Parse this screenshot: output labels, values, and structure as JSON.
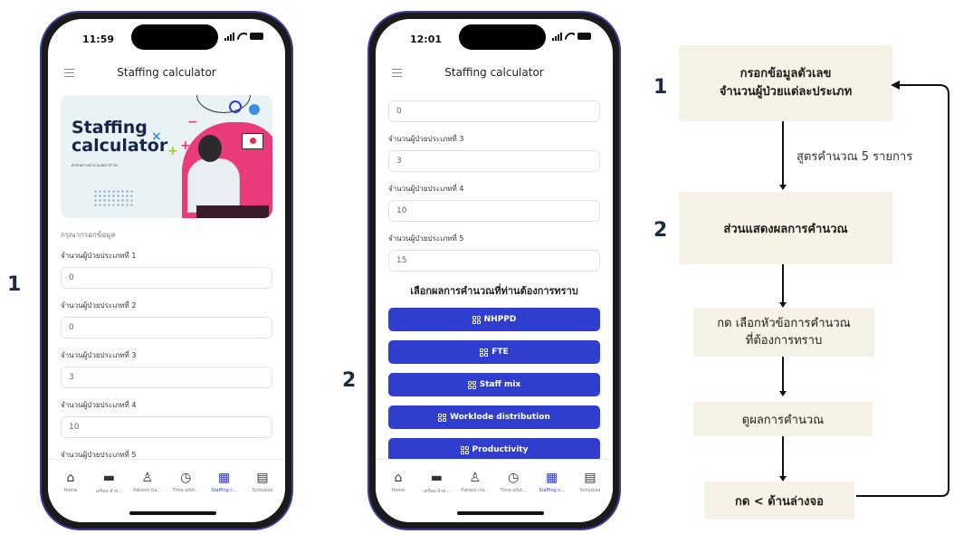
{
  "labels": {
    "step1": "1",
    "step2": "2"
  },
  "phone1": {
    "time": "11:59",
    "title": "Staffing calculator",
    "banner": {
      "title": "Staffing calculator",
      "subtitle": "ตัวช่วยการคำนวณอัตรากำลัง"
    },
    "hint": "กรุณากรอกข้อมูล",
    "fields": [
      {
        "label": "จำนวนผู้ป่วยประเภทที่ 1",
        "value": "0"
      },
      {
        "label": "จำนวนผู้ป่วยประเภทที่ 2",
        "value": "0"
      },
      {
        "label": "จำนวนผู้ป่วยประเภทที่ 3",
        "value": "3"
      },
      {
        "label": "จำนวนผู้ป่วยประเภทที่ 4",
        "value": "10"
      },
      {
        "label": "จำนวนผู้ป่วยประเภทที่ 5",
        "value": ""
      }
    ]
  },
  "phone2": {
    "time": "12:01",
    "title": "Staffing calculator",
    "fields": [
      {
        "label": "",
        "value": "0"
      },
      {
        "label": "จำนวนผู้ป่วยประเภทที่ 3",
        "value": "3"
      },
      {
        "label": "จำนวนผู้ป่วยประเภทที่ 4",
        "value": "10"
      },
      {
        "label": "จำนวนผู้ป่วยประเภทที่ 5",
        "value": "15"
      }
    ],
    "section_title": "เลือกผลการคำนวณที่ท่านต้องการทราบ",
    "buttons": [
      "NHPPD",
      "FTE",
      "Staff mix",
      "Worklode distribution",
      "Productivity"
    ]
  },
  "tabbar": {
    "items": [
      {
        "label": "Home",
        "icon": "home-icon"
      },
      {
        "label": "เตรียม-จำห...",
        "icon": "bed-icon"
      },
      {
        "label": "Patient cla...",
        "icon": "patient-icon"
      },
      {
        "label": "Time allot...",
        "icon": "clock-icon"
      },
      {
        "label": "Staffing c...",
        "icon": "calculator-icon"
      },
      {
        "label": "Schedule",
        "icon": "document-icon"
      }
    ],
    "active_color": "#2f3ecf"
  },
  "flow": {
    "num1": "1",
    "num2": "2",
    "box1": "กรอกข้อมูลตัวเลข\nจำนวนผู้ป่วยแต่ละประเภท",
    "edge1": "สูตรคำนวณ 5 รายการ",
    "box2": "ส่วนแสดงผลการคำนวณ",
    "box3": "กด เลือกหัวข้อการคำนวณ\nที่ต้องการทราบ",
    "box4": "ดูผลการคำนวณ",
    "box5": "กด < ด้านล่างจอ",
    "box_bg": "#f7f2e6"
  }
}
